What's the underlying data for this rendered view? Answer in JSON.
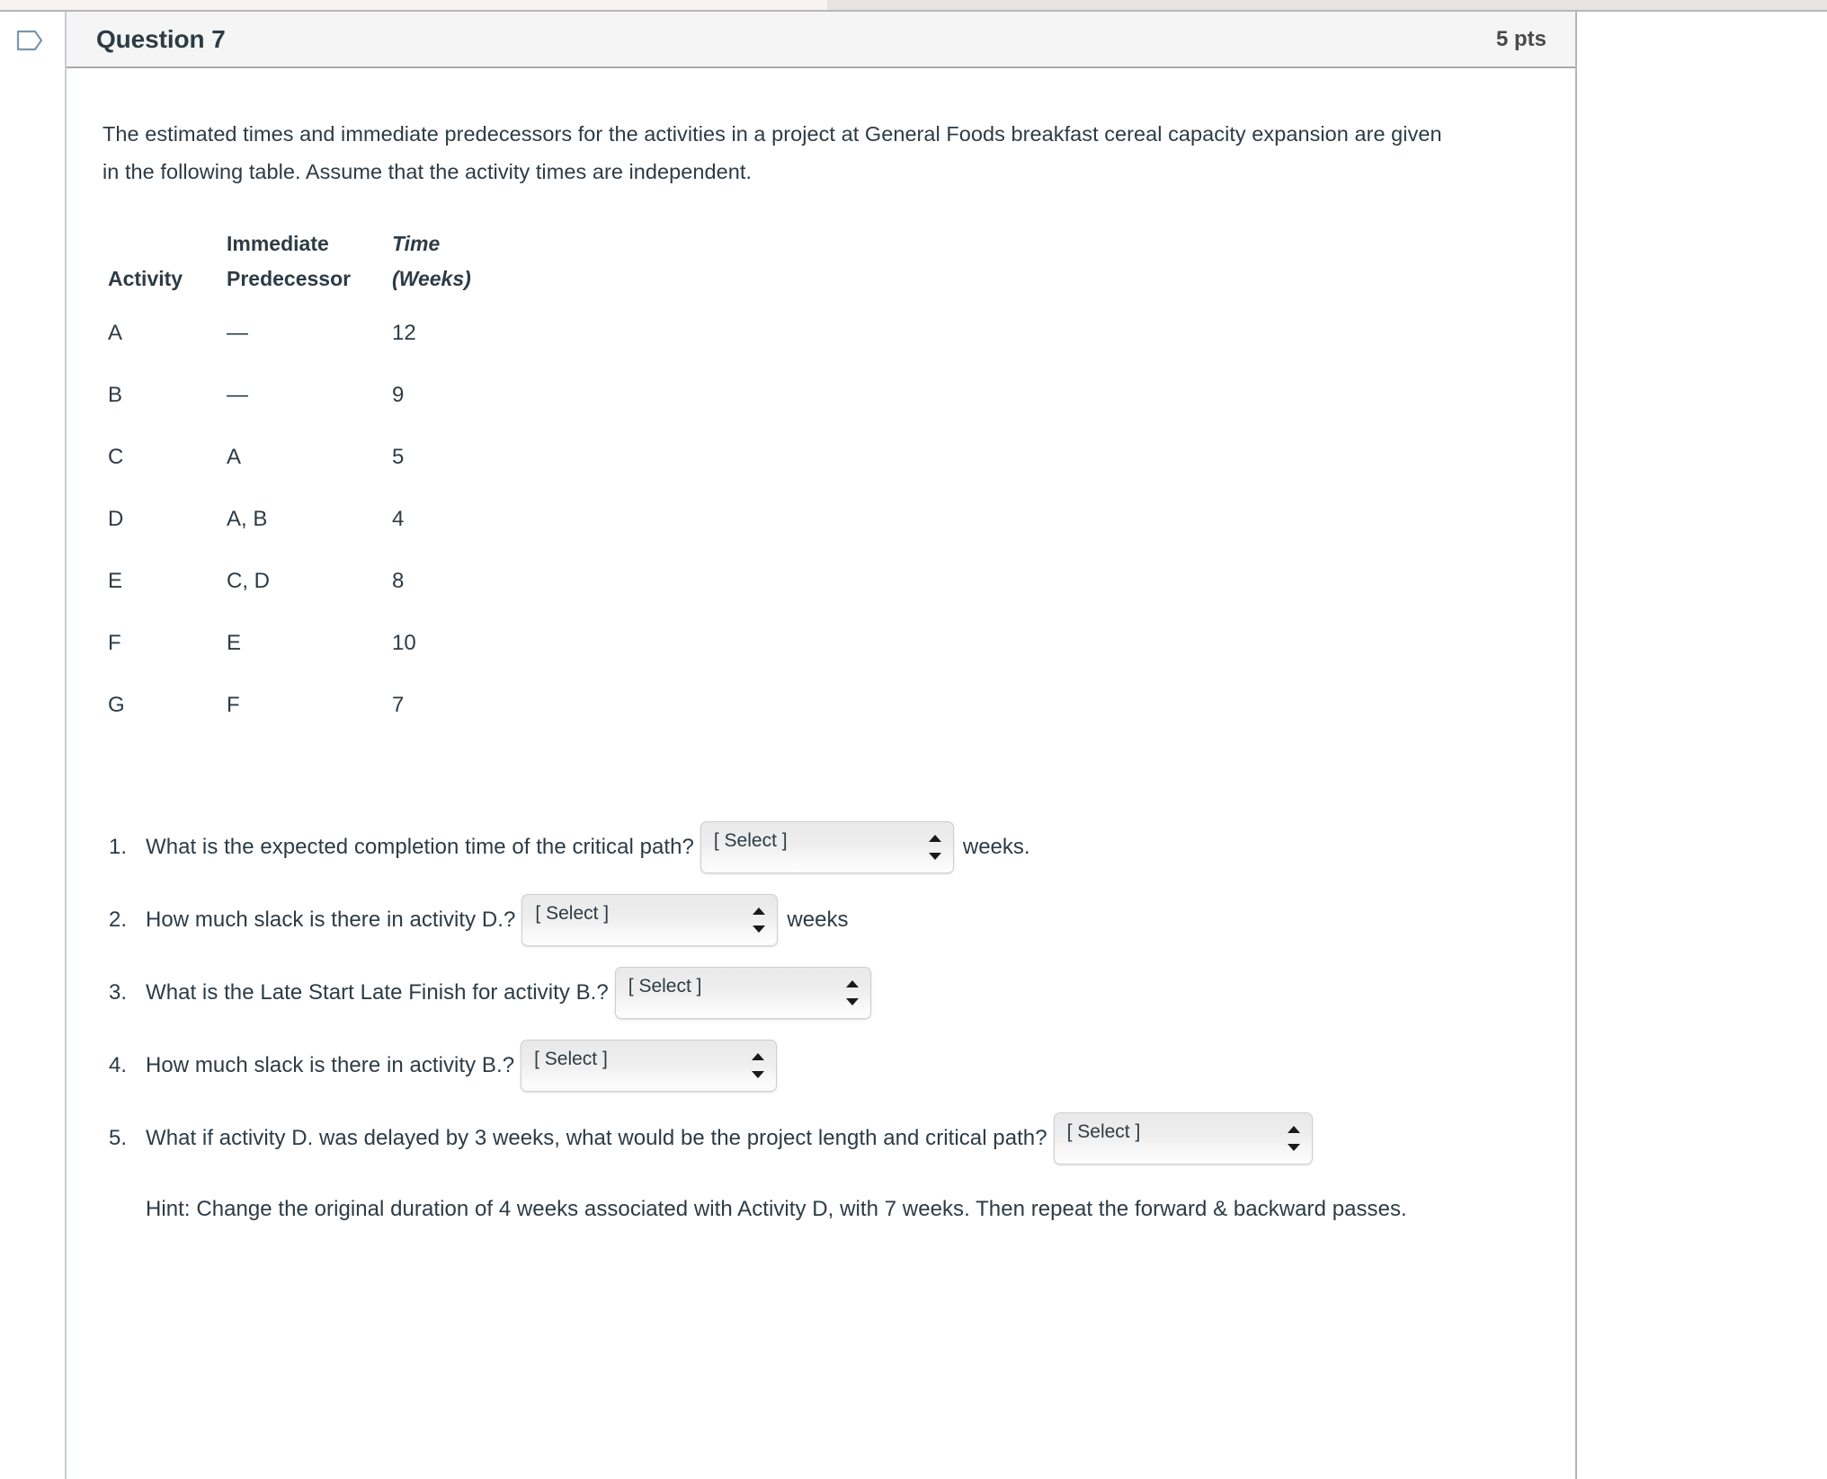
{
  "header": {
    "title": "Question 7",
    "points": "5 pts",
    "flag_icon": "bookmark-flag-icon"
  },
  "intro": "The estimated times and immediate predecessors for the activities in a project at General Foods breakfast cereal capacity expansion are given in the following table. Assume that the activity times are independent.",
  "table": {
    "headers": {
      "activity": "Activity",
      "predecessor_line1": "Immediate",
      "predecessor_line2": "Predecessor",
      "time_line1": "Time",
      "time_line2": "(Weeks)"
    },
    "rows": [
      {
        "activity": "A",
        "predecessor": "—",
        "time": "12"
      },
      {
        "activity": "B",
        "predecessor": "—",
        "time": "9"
      },
      {
        "activity": "C",
        "predecessor": "A",
        "time": "5"
      },
      {
        "activity": "D",
        "predecessor": "A, B",
        "time": "4"
      },
      {
        "activity": "E",
        "predecessor": "C, D",
        "time": "8"
      },
      {
        "activity": "F",
        "predecessor": "E",
        "time": "10"
      },
      {
        "activity": "G",
        "predecessor": "F",
        "time": "7"
      }
    ]
  },
  "questions": [
    {
      "number": "1.",
      "text": "What is the expected completion time of the critical path?",
      "select_value": "[ Select ]",
      "suffix": "weeks."
    },
    {
      "number": "2.",
      "text": "How much slack is there in activity D.?",
      "select_value": "[ Select ]",
      "suffix": "weeks"
    },
    {
      "number": "3.",
      "text": "What is the Late Start Late Finish for activity B.?",
      "select_value": "[ Select ]",
      "suffix": ""
    },
    {
      "number": "4.",
      "text": "How much slack is there in activity B.?",
      "select_value": "[ Select ]",
      "suffix": ""
    },
    {
      "number": "5.",
      "text": "What if activity D. was delayed by 3 weeks, what would be the project length and critical path?",
      "select_value": "[ Select ]",
      "suffix": ""
    }
  ],
  "hint": "Hint: Change the original duration of 4 weeks associated with Activity D, with 7 weeks. Then repeat the forward & backward passes.",
  "colors": {
    "text": "#2d3b45",
    "header_bg": "#f5f5f5",
    "flag_outline": "#7a96ad"
  }
}
